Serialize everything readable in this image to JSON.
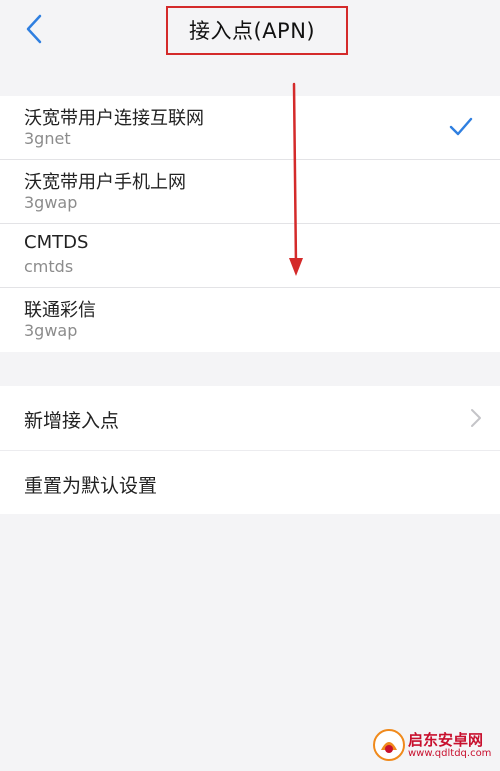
{
  "header": {
    "title": "接入点(APN)",
    "back_icon": "chevron-left-icon"
  },
  "apn_list": [
    {
      "name": "沃宽带用户连接互联网",
      "apn": "3gnet",
      "selected": true
    },
    {
      "name": "沃宽带用户手机上网",
      "apn": "3gwap",
      "selected": false
    },
    {
      "name": "CMTDS",
      "apn": "cmtds",
      "selected": false
    },
    {
      "name": "联通彩信",
      "apn": "3gwap",
      "selected": false
    }
  ],
  "actions": {
    "add_apn": "新增接入点",
    "reset_default": "重置为默认设置"
  },
  "watermark": {
    "name": "启东安卓网",
    "url": "www.qdltdq.com"
  },
  "colors": {
    "accent": "#2f7fe0",
    "annotation_red": "#d42a2a",
    "background": "#f4f4f6"
  }
}
